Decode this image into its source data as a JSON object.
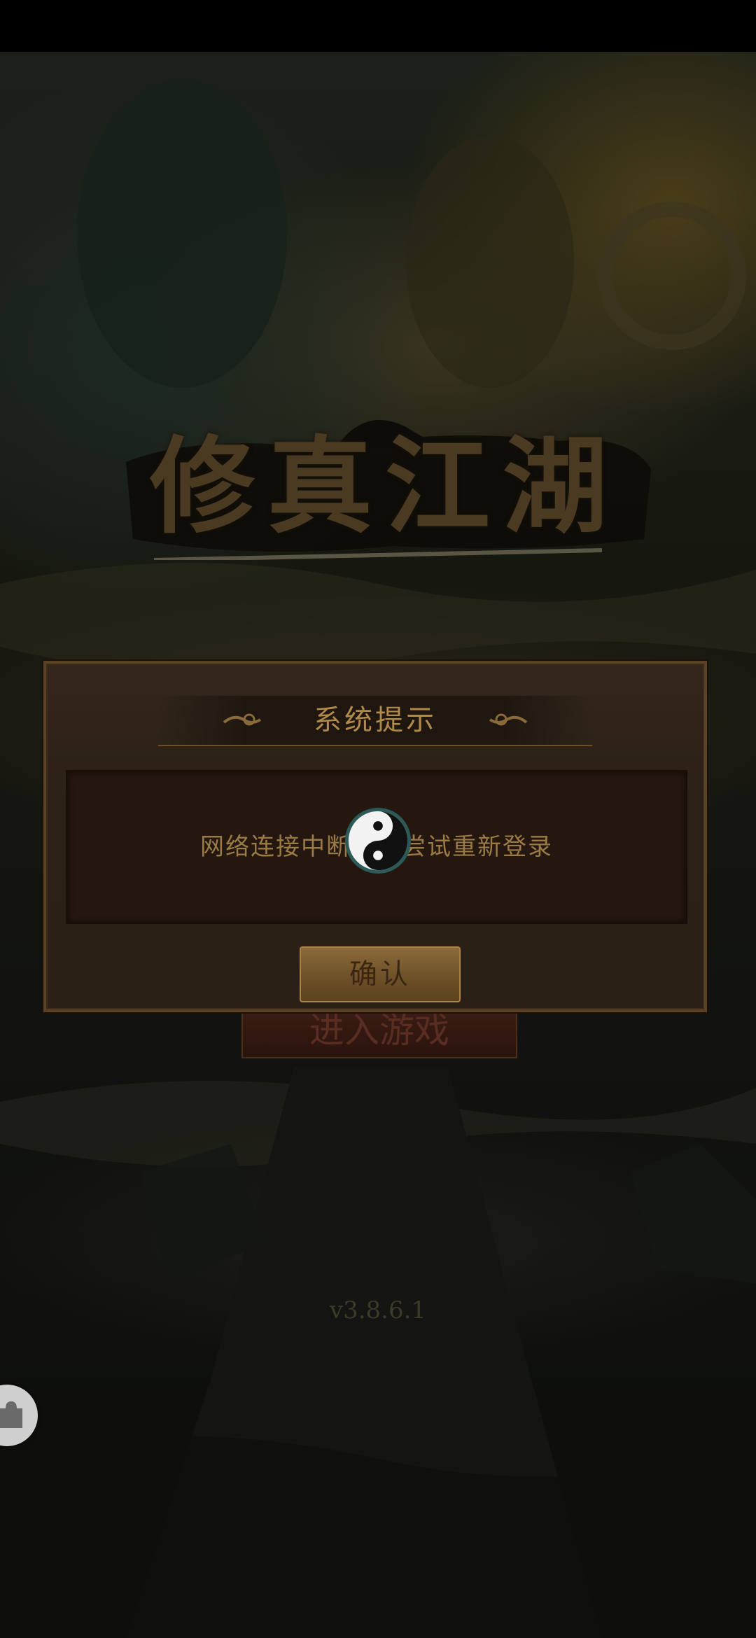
{
  "game": {
    "logo_title": "修真江湖",
    "enter_button_label": "进入游戏",
    "version": "v3.8.6.1"
  },
  "dialog": {
    "title": "系统提示",
    "message": "网络连接中断，请尝试重新登录",
    "confirm_label": "确认"
  },
  "icons": {
    "loading": "yin-yang-icon",
    "float_ball": "puzzle-icon",
    "title_ornaments": "cloud-scroll-icon"
  },
  "colors": {
    "dialog_title": "#b08a4a",
    "message_text": "#9a7a45",
    "button_gold": "#8a6a3a",
    "dialog_border": "#5a4324"
  }
}
